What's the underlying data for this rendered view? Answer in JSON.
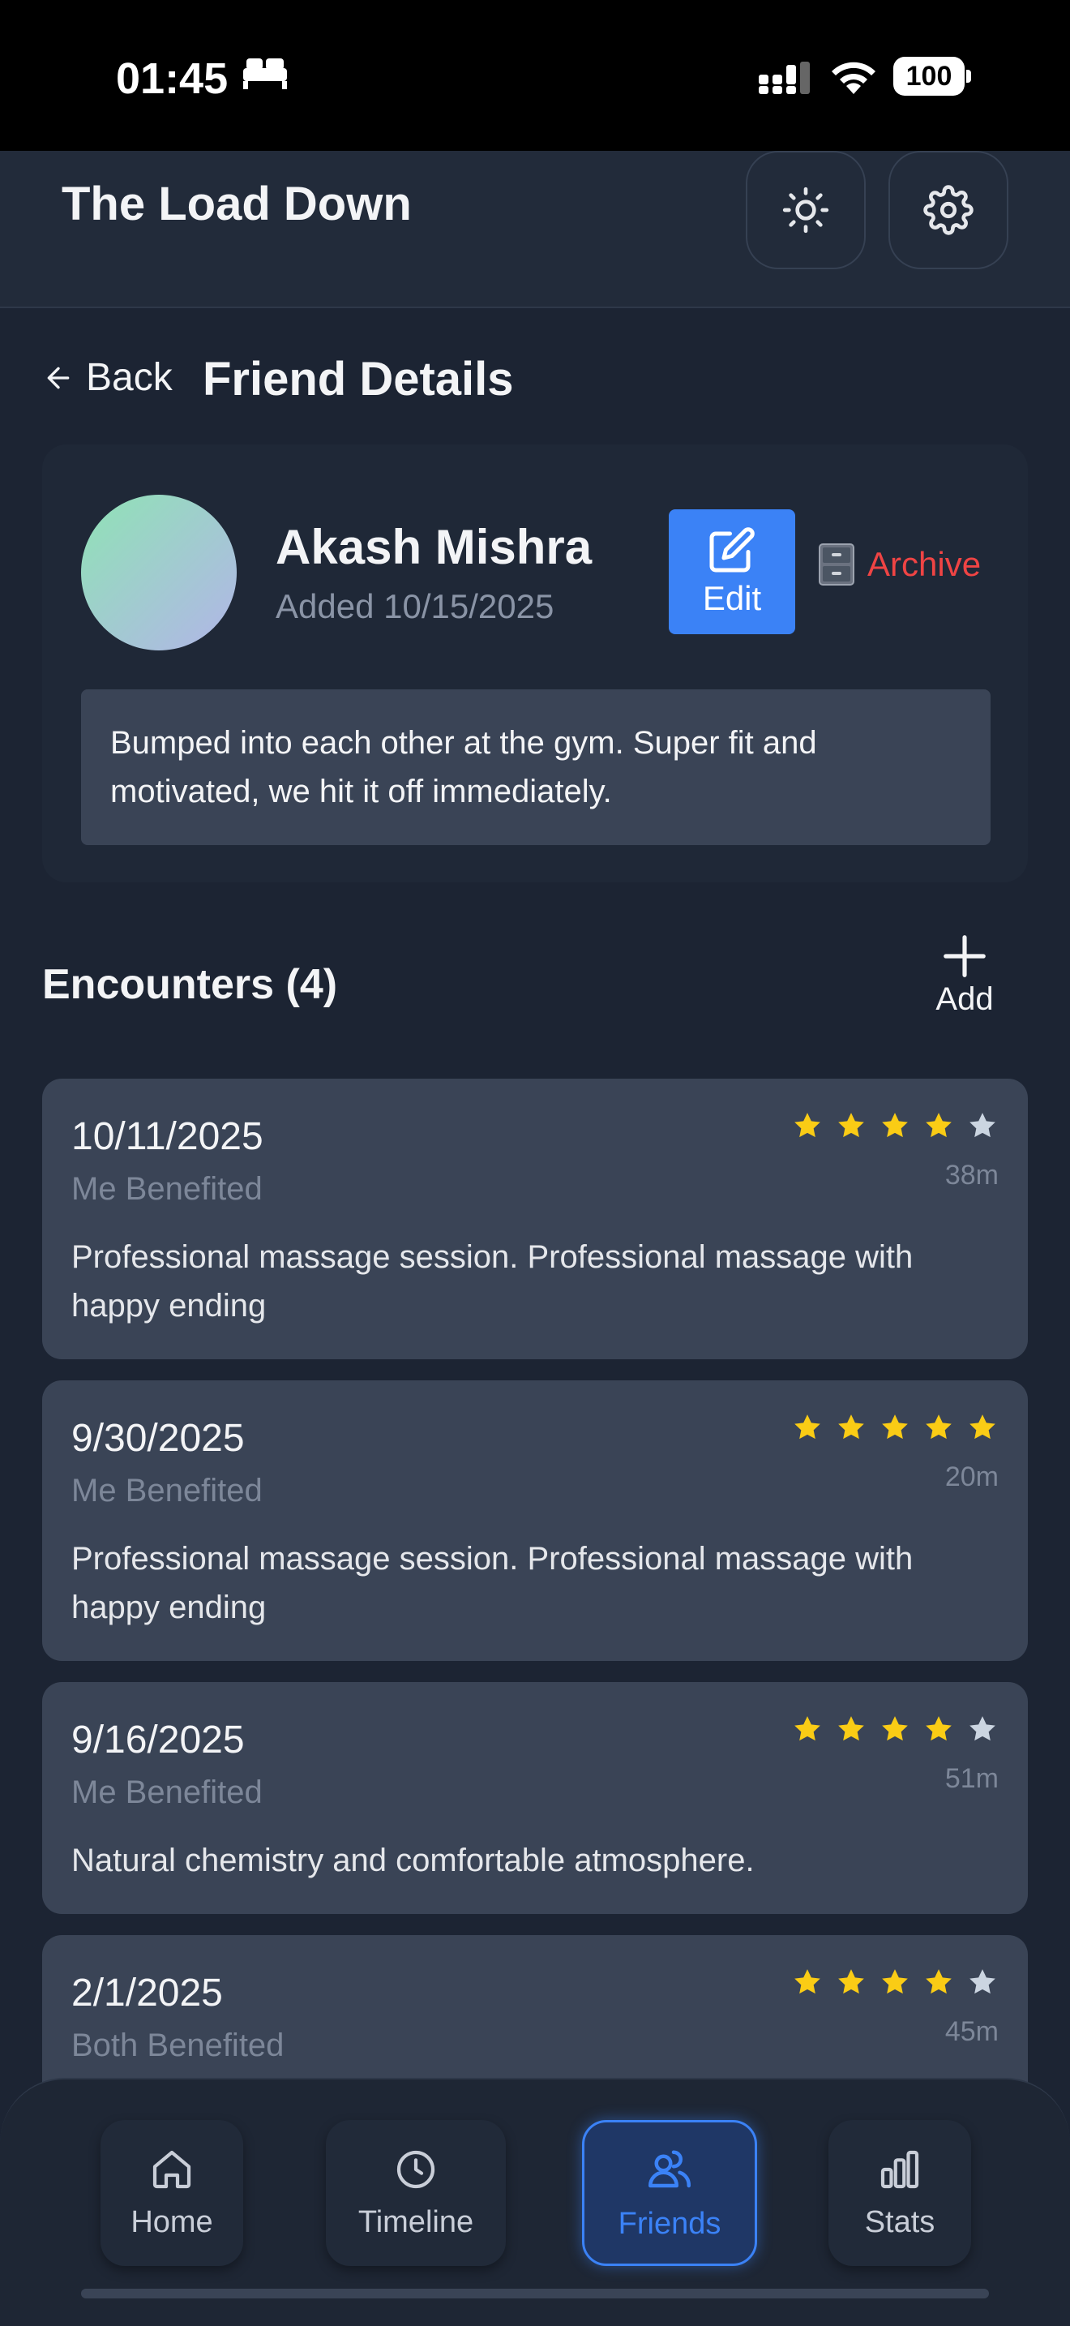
{
  "status_bar": {
    "time": "01:45",
    "battery": "100"
  },
  "header": {
    "title": "The Load Down"
  },
  "page": {
    "back_label": "Back",
    "title": "Friend Details"
  },
  "friend": {
    "name": "Akash Mishra",
    "added": "Added 10/15/2025",
    "edit_label": "Edit",
    "archive_label": "Archive",
    "notes": "Bumped into each other at the gym. Super fit and motivated, we hit it off immediately."
  },
  "encounters": {
    "title": "Encounters (4)",
    "add_label": "Add",
    "items": [
      {
        "date": "10/11/2025",
        "type": "Me Benefited",
        "rating": 4,
        "duration": "38m",
        "note": "Professional massage session. Professional massage with happy ending"
      },
      {
        "date": "9/30/2025",
        "type": "Me Benefited",
        "rating": 5,
        "duration": "20m",
        "note": "Professional massage session. Professional massage with happy ending"
      },
      {
        "date": "9/16/2025",
        "type": "Me Benefited",
        "rating": 4,
        "duration": "51m",
        "note": "Natural chemistry and comfortable atmosphere."
      },
      {
        "date": "2/1/2025",
        "type": "Both Benefited",
        "rating": 4,
        "duration": "45m",
        "note": ""
      }
    ]
  },
  "nav": {
    "home": "Home",
    "timeline": "Timeline",
    "friends": "Friends",
    "stats": "Stats"
  },
  "colors": {
    "accent": "#3b82f6",
    "star": "#facc15",
    "star_empty": "#cbd5e1",
    "danger": "#ef4444"
  }
}
